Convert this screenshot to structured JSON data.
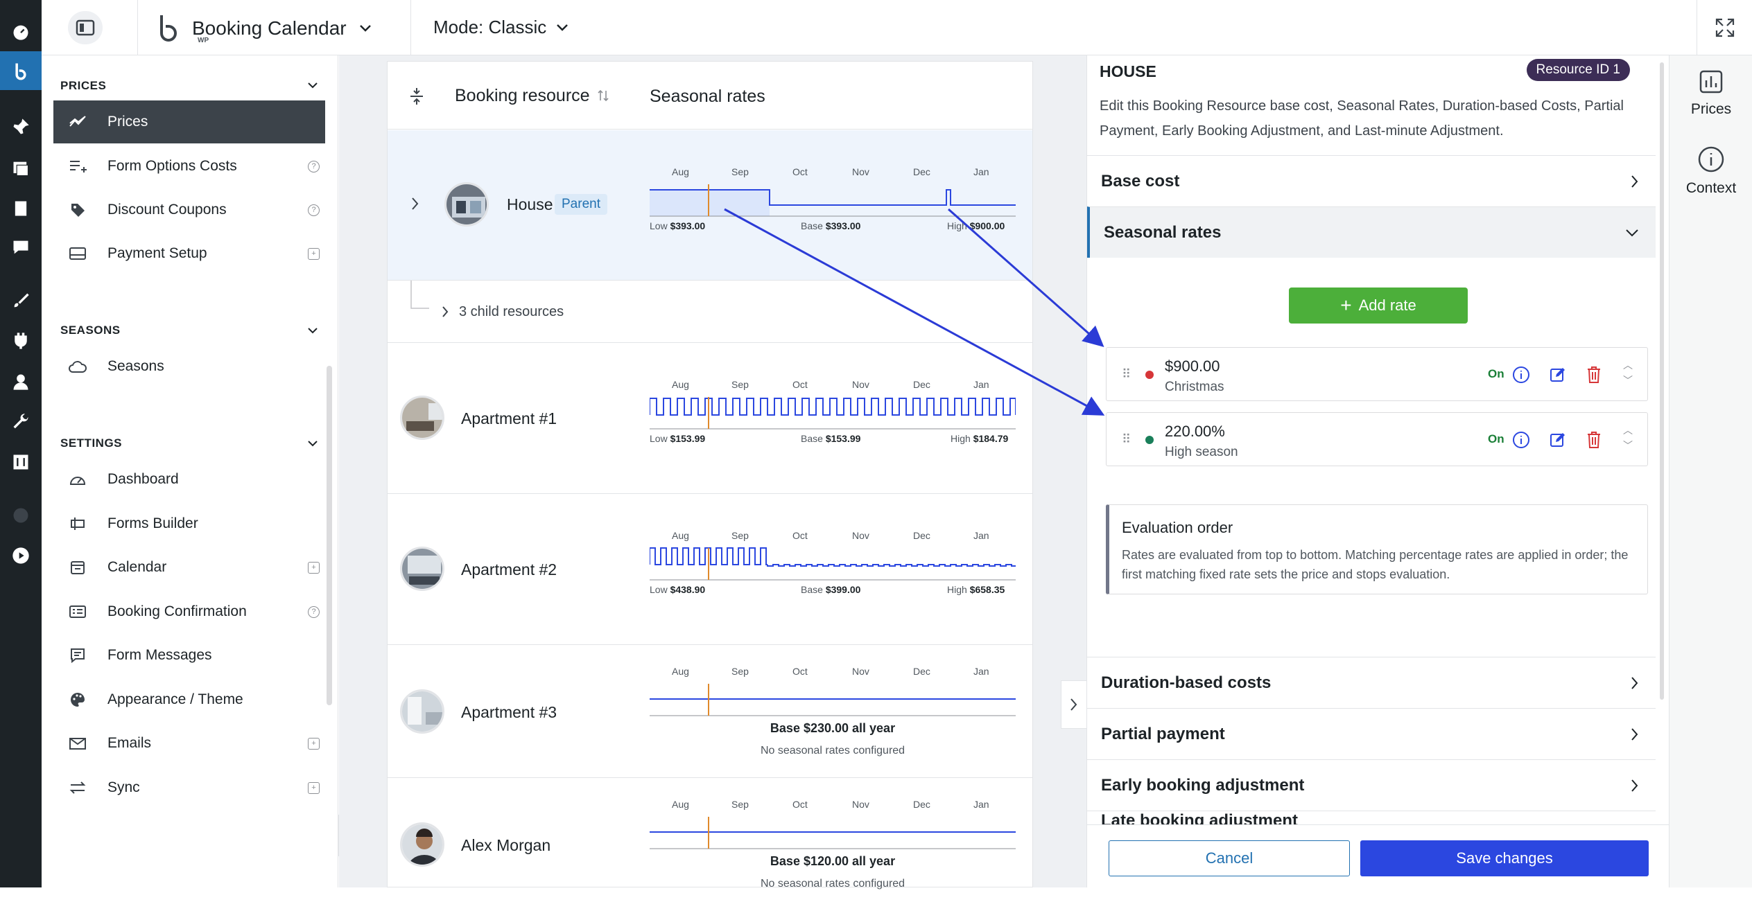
{
  "app": {
    "title": "Booking Calendar",
    "subtitle": "WP",
    "mode_label": "Mode: Classic"
  },
  "colors": {
    "accent": "#2271b1",
    "save": "#2b47e0",
    "add": "#4caf3a",
    "nav_active": "#3c434a",
    "resource_badge": "#3c2d56",
    "christmas_dot": "#d63638",
    "highseason_dot": "#1a7f5a"
  },
  "nav": {
    "prices_section": "PRICES",
    "prices_items": [
      {
        "label": "Prices",
        "icon": "chart-line-icon"
      },
      {
        "label": "Form Options Costs",
        "icon": "list-plus-icon"
      },
      {
        "label": "Discount Coupons",
        "icon": "tag-icon"
      },
      {
        "label": "Payment Setup",
        "icon": "card-icon"
      }
    ],
    "seasons_section": "SEASONS",
    "seasons_items": [
      {
        "label": "Seasons",
        "icon": "cloud-icon"
      }
    ],
    "settings_section": "SETTINGS",
    "settings_items": [
      {
        "label": "Dashboard",
        "icon": "gauge-icon"
      },
      {
        "label": "Forms Builder",
        "icon": "form-icon"
      },
      {
        "label": "Calendar",
        "icon": "calendar-icon"
      },
      {
        "label": "Booking Confirmation",
        "icon": "id-card-icon"
      },
      {
        "label": "Form Messages",
        "icon": "message-icon"
      },
      {
        "label": "Appearance / Theme",
        "icon": "palette-icon"
      },
      {
        "label": "Emails",
        "icon": "mail-icon"
      },
      {
        "label": "Sync",
        "icon": "sync-icon"
      }
    ]
  },
  "list": {
    "header": {
      "resource": "Booking resource",
      "rates": "Seasonal rates"
    },
    "months": [
      "Aug",
      "Sep",
      "Oct",
      "Nov",
      "Dec",
      "Jan"
    ],
    "child_resources": "3 child resources",
    "rows": [
      {
        "name": "House",
        "badge": "Parent",
        "low_label": "Low",
        "low": "$393.00",
        "base_label": "Base",
        "base": "$393.00",
        "high_label": "High",
        "high": "$900.00"
      },
      {
        "name": "Apartment #1",
        "low_label": "Low",
        "low": "$153.99",
        "base_label": "Base",
        "base": "$153.99",
        "high_label": "High",
        "high": "$184.79"
      },
      {
        "name": "Apartment #2",
        "low_label": "Low",
        "low": "$438.90",
        "base_label": "Base",
        "base": "$399.00",
        "high_label": "High",
        "high": "$658.35"
      },
      {
        "name": "Apartment #3",
        "base_text": "Base $230.00 all year",
        "none_text": "No seasonal rates configured"
      },
      {
        "name": "Alex Morgan",
        "base_text": "Base $120.00 all year",
        "none_text": "No seasonal rates configured"
      }
    ]
  },
  "panel": {
    "title": "HOUSE",
    "resource_id": "Resource ID 1",
    "description": "Edit this Booking Resource base cost, Seasonal Rates, Duration-based Costs, Partial Payment, Early Booking Adjustment, and Last-minute Adjustment.",
    "sections": {
      "base_cost": "Base cost",
      "seasonal_rates": "Seasonal rates",
      "duration": "Duration-based costs",
      "partial": "Partial payment",
      "early": "Early booking adjustment",
      "late": "Late booking adjustment"
    },
    "add_rate": "Add rate",
    "rates": [
      {
        "amount": "$900.00",
        "name": "Christmas",
        "status": "On"
      },
      {
        "amount": "220.00%",
        "name": "High season",
        "status": "On"
      }
    ],
    "eval": {
      "title": "Evaluation order",
      "text": "Rates are evaluated from top to bottom. Matching percentage rates are applied in order; the first matching fixed rate sets the price and stops evaluation."
    },
    "cancel": "Cancel",
    "save": "Save changes"
  },
  "right_tabs": {
    "prices": "Prices",
    "context": "Context"
  }
}
